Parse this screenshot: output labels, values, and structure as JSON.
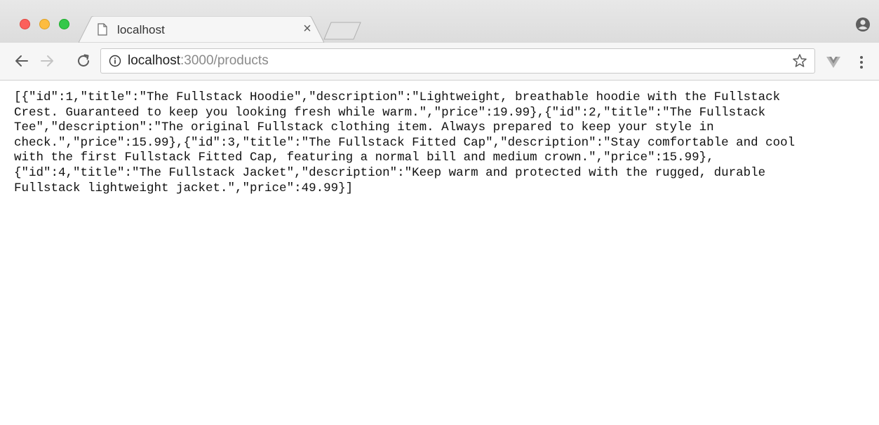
{
  "window": {
    "traffic_lights": {
      "close": "#fc605c",
      "minimize": "#fdbc40",
      "maximize": "#34c84a"
    }
  },
  "tab": {
    "title": "localhost",
    "close_glyph": "×",
    "icon": "document-icon"
  },
  "toolbar": {
    "back_icon": "arrow-left-icon",
    "forward_icon": "arrow-right-icon",
    "reload_icon": "reload-icon",
    "url_host": "localhost",
    "url_rest": ":3000/products",
    "info_icon": "info-icon",
    "bookmark_icon": "star-icon",
    "extension_icon": "vue-devtools-icon",
    "menu_icon": "more-vert-icon"
  },
  "profile_icon": "profile-icon",
  "content": {
    "json_text": "[{\"id\":1,\"title\":\"The Fullstack Hoodie\",\"description\":\"Lightweight, breathable hoodie with the Fullstack\nCrest. Guaranteed to keep you looking fresh while warm.\",\"price\":19.99},{\"id\":2,\"title\":\"The Fullstack\nTee\",\"description\":\"The original Fullstack clothing item. Always prepared to keep your style in\ncheck.\",\"price\":15.99},{\"id\":3,\"title\":\"The Fullstack Fitted Cap\",\"description\":\"Stay comfortable and cool\nwith the first Fullstack Fitted Cap, featuring a normal bill and medium crown.\",\"price\":15.99},\n{\"id\":4,\"title\":\"The Fullstack Jacket\",\"description\":\"Keep warm and protected with the rugged, durable\nFullstack lightweight jacket.\",\"price\":49.99}]"
  }
}
